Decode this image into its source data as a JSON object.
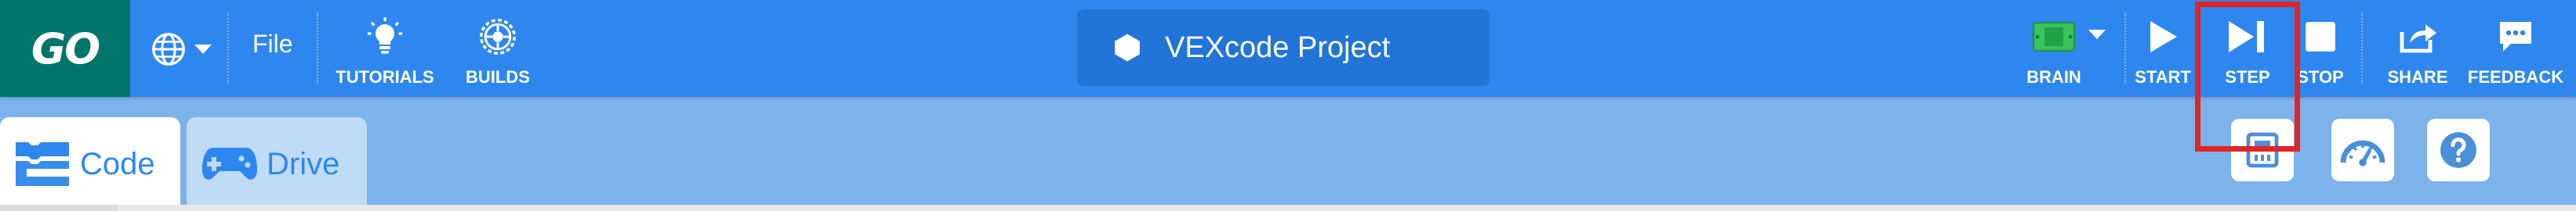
{
  "app": {
    "logo_text": "GO",
    "project_name": "VEXcode Project",
    "colors": {
      "toolbar": "#2d87ee",
      "logo_bg": "#00766b",
      "project_box": "#2174d8",
      "tab_bar": "#7cb3ea",
      "brain_green": "#37c45e",
      "highlight": "#e12424"
    }
  },
  "toolbar": {
    "language_icon": "globe-icon",
    "file_menu": "File",
    "tutorials": "TUTORIALS",
    "builds": "BUILDS",
    "brain": "BRAIN",
    "start": "START",
    "step": "STEP",
    "stop": "STOP",
    "share": "SHARE",
    "feedback": "FEEDBACK"
  },
  "tabs": [
    {
      "label": "Code",
      "icon": "blocks-icon",
      "active": true
    },
    {
      "label": "Drive",
      "icon": "gamepad-icon",
      "active": false
    }
  ],
  "right_panel": {
    "buttons": [
      "devices-icon",
      "dashboard-icon",
      "help-icon"
    ]
  }
}
